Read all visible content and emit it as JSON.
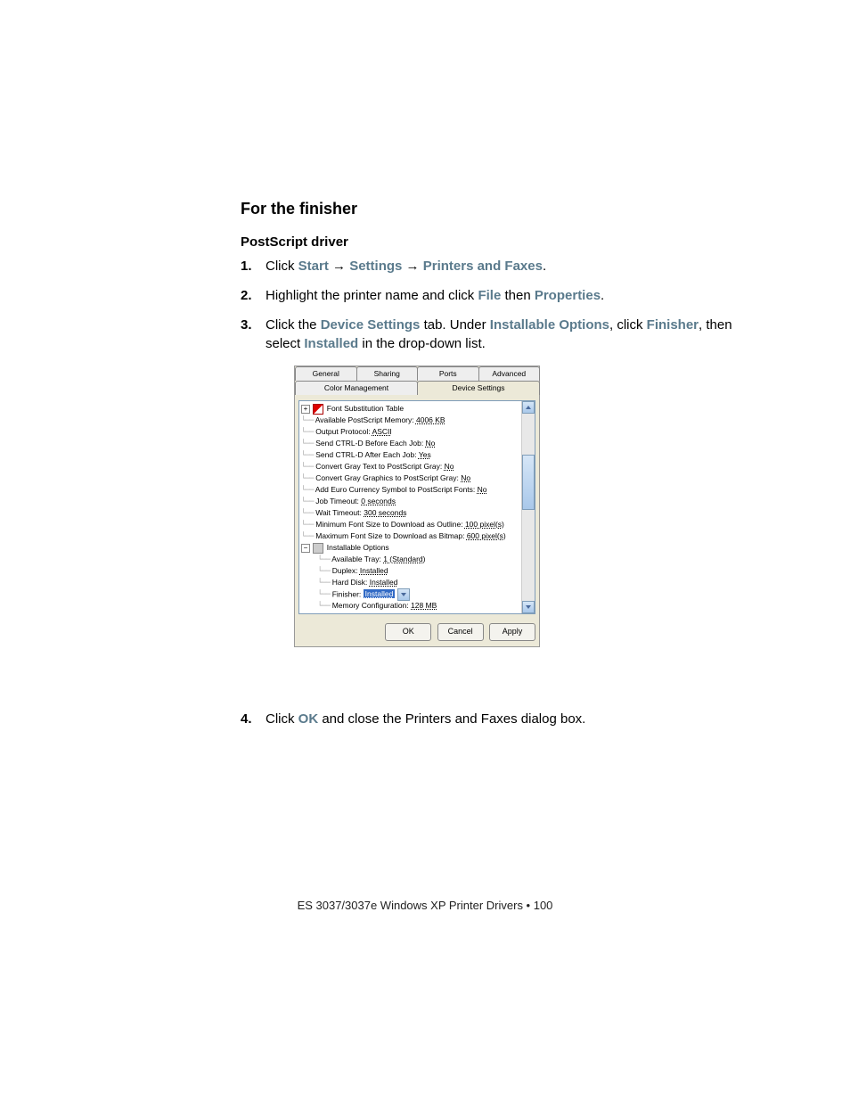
{
  "heading1": "For the finisher",
  "heading2": "PostScript driver",
  "steps": {
    "s1_click": "Click ",
    "s1_start": "Start",
    "s1_arrow": " → ",
    "s1_settings": "Settings",
    "s1_pf": "Printers and Faxes",
    "s1_end": ".",
    "s2_a": "Highlight the printer name and click ",
    "s2_file": "File",
    "s2_b": " then ",
    "s2_props": "Properties",
    "s2_end": ".",
    "s3_a": "Click the ",
    "s3_ds": "Device Settings",
    "s3_b": " tab. Under ",
    "s3_io": "Installable Options",
    "s3_c": ", click ",
    "s3_fin": "Finisher",
    "s3_d": ", then select ",
    "s3_inst": "Installed",
    "s3_e": " in the drop-down list.",
    "s4_a": "Click ",
    "s4_ok": "OK",
    "s4_b": " and close the Printers and Faxes dialog box."
  },
  "dialog": {
    "tabs1": [
      "General",
      "Sharing",
      "Ports",
      "Advanced"
    ],
    "tabs2": [
      "Color Management",
      "Device Settings"
    ],
    "rows": {
      "r0": "Font Substitution Table",
      "r1a": "Available PostScript Memory: ",
      "r1v": "4006 KB",
      "r2a": "Output Protocol: ",
      "r2v": "ASCII",
      "r3a": "Send CTRL-D Before Each Job: ",
      "r3v": "No",
      "r4a": "Send CTRL-D After Each Job: ",
      "r4v": "Yes",
      "r5a": "Convert Gray Text to PostScript Gray: ",
      "r5v": "No",
      "r6a": "Convert Gray Graphics to PostScript Gray: ",
      "r6v": "No",
      "r7a": "Add Euro Currency Symbol to PostScript Fonts: ",
      "r7v": "No",
      "r8a": "Job Timeout: ",
      "r8v": "0 seconds",
      "r9a": "Wait Timeout: ",
      "r9v": "300 seconds",
      "r10a": "Minimum Font Size to Download as Outline: ",
      "r10v": "100 pixel(s)",
      "r11a": "Maximum Font Size to Download as Bitmap: ",
      "r11v": "600 pixel(s)",
      "r12": "Installable Options",
      "r13a": "Available Tray: ",
      "r13v": "1 (Standard)",
      "r14a": "Duplex: ",
      "r14v": "Installed",
      "r15a": "Hard Disk: ",
      "r15v": "Installed",
      "r16a": "Finisher: ",
      "r16v": "Installed",
      "r17a": "Memory Configuration: ",
      "r17v": "128 MB"
    },
    "buttons": {
      "ok": "OK",
      "cancel": "Cancel",
      "apply": "Apply"
    }
  },
  "footer": "ES 3037/3037e Windows XP Printer Drivers • 100"
}
